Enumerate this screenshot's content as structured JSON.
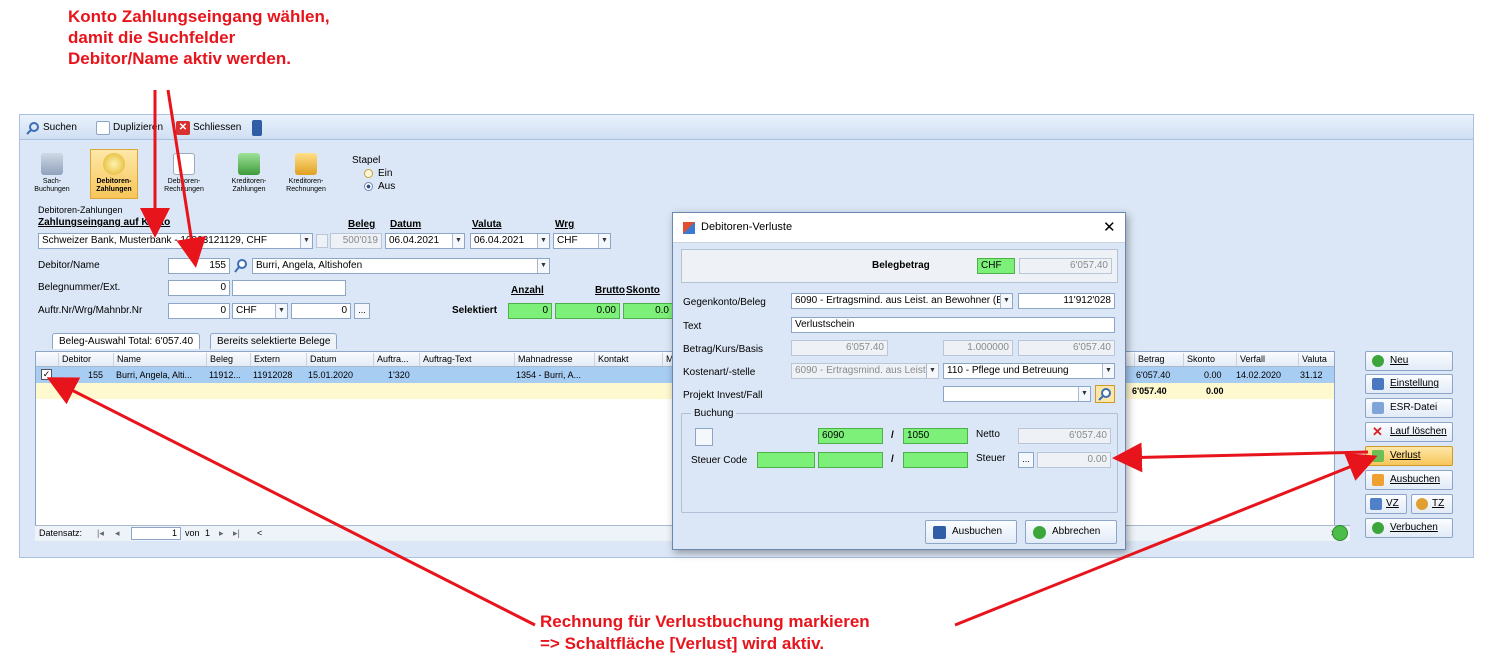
{
  "annotations": {
    "top_line1": "Konto Zahlungseingang wählen,",
    "top_line2": "damit die Suchfelder",
    "top_line3": "Debitor/Name aktiv werden.",
    "bottom_line1": "Rechnung für Verlustbuchung markieren",
    "bottom_line2": "=> Schaltfläche [Verlust] wird aktiv.",
    "color": "#e8141c"
  },
  "toolbar": {
    "search_label": "Suchen",
    "duplicate_label": "Duplizieren",
    "close_label": "Schliessen"
  },
  "ribbon": {
    "sach_label": "Sach-\nBuchungen",
    "debitoren_zahlungen_label": "Debitoren-\nZahlungen",
    "debitoren_rechnungen_label": "Debitoren-\nRechnungen",
    "kreditoren_zahlungen_label": "Kreditoren-\nZahlungen",
    "kreditoren_rechnungen_label": "Kreditoren-\nRechnungen",
    "stapel_label": "Stapel",
    "stapel_ein": "Ein",
    "stapel_aus": "Aus",
    "stapel_selected": "Aus"
  },
  "form": {
    "group_label": "Debitoren-Zahlungen",
    "konto_label": "Zahlungseingang auf Konto",
    "konto_value": "Schweizer Bank, Musterbank - 10003121129, CHF",
    "beleg_label": "Beleg",
    "beleg_value": "500'019",
    "datum_label": "Datum",
    "datum_value": "06.04.2021",
    "valuta_label": "Valuta",
    "valuta_value": "06.04.2021",
    "wrg_label": "Wrg",
    "wrg_value": "CHF",
    "debitor_label": "Debitor/Name",
    "debitor_nr": "155",
    "debitor_name": "Burri, Angela, Altishofen",
    "belegnummer_label": "Belegnummer/Ext.",
    "belegnummer_value": "0",
    "auftr_label": "Auftr.Nr/Wrg/Mahnbr.Nr",
    "auftr_nr": "0",
    "auftr_wrg": "CHF",
    "auftr_mahn": "0",
    "ellipsis": "...",
    "selektiert_label": "Selektiert",
    "anzahl_label": "Anzahl",
    "anzahl_value": "0",
    "brutto_label": "Brutto",
    "brutto_value": "0.00",
    "skonto_label": "Skonto",
    "skonto_value": "0.0"
  },
  "tabs": [
    {
      "label": "Beleg-Auswahl Total: 6'057.40"
    },
    {
      "label": "Bereits selektierte Belege"
    }
  ],
  "grid": {
    "headers": [
      "Debitor",
      "Name",
      "Beleg",
      "Extern",
      "Datum",
      "Auftra...",
      "Auftrag-Text",
      "Mahnadresse",
      "Kontakt",
      "M",
      "Betrag",
      "Skonto",
      "Verfall",
      "Valuta"
    ],
    "row": {
      "checked": "✓",
      "debitor": "155",
      "name": "Burri, Angela, Alti...",
      "beleg": "11912...",
      "extern": "11912028",
      "datum": "15.01.2020",
      "auftrag": "1'320",
      "mahnadresse": "1354 - Burri, A...",
      "betrag": "6'057.40",
      "skonto": "0.00",
      "verfall": "14.02.2020",
      "valuta": "31.12"
    },
    "sum": {
      "betrag": "6'057.40",
      "skonto": "0.00"
    },
    "status": {
      "label": "Datensatz:",
      "current": "1",
      "von": "von",
      "total": "1"
    }
  },
  "side_buttons": [
    {
      "label": "Neu",
      "icon": "plus-circle-icon"
    },
    {
      "label": "Einstellung",
      "icon": "settings-icon"
    },
    {
      "label": "ESR-Datei",
      "icon": "file-icon"
    },
    {
      "label": "Lauf löschen",
      "icon": "delete-x-icon"
    },
    {
      "label": "Verlust",
      "icon": "loss-icon"
    },
    {
      "label": "Ausbuchen",
      "icon": "ausbuchen-icon"
    },
    {
      "label": "VZ",
      "icon": "vz-icon"
    },
    {
      "label": "TZ",
      "icon": "tz-icon"
    },
    {
      "label": "Verbuchen",
      "icon": "check-circle-icon"
    }
  ],
  "dialog": {
    "title": "Debitoren-Verluste",
    "belegbetrag_label": "Belegbetrag",
    "belegbetrag_wrg": "CHF",
    "belegbetrag_value": "6'057.40",
    "gegenkonto_label": "Gegenkonto/Beleg",
    "gegenkonto_value": "6090 - Ertragsmind. aus Leist. an Bewohner (E",
    "beleg_value": "11'912'028",
    "text_label": "Text",
    "text_value": "Verlustschein",
    "betrag_label": "Betrag/Kurs/Basis",
    "betrag_value": "6'057.40",
    "kurs_value": "1.000000",
    "basis_value": "6'057.40",
    "kostenart_label": "Kostenart/-stelle",
    "kostenart_value": "6090 - Ertragsmind. aus Leist",
    "kostenstelle_value": "110 - Pflege und Betreuung",
    "projekt_label": "Projekt Invest/Fall",
    "projekt_value": "",
    "buchung_label": "Buchung",
    "soll_value": "6090",
    "slash": "/",
    "haben_value": "1050",
    "netto_label": "Netto",
    "netto_value": "6'057.40",
    "steuer_code_label": "Steuer Code",
    "steuer_label": "Steuer",
    "steuer_value": "0.00",
    "ellipsis": "...",
    "ausbuchen_label": "Ausbuchen",
    "abbrechen_label": "Abbrechen"
  }
}
